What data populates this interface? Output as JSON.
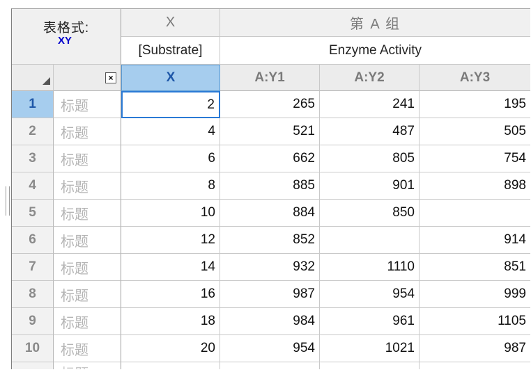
{
  "table_format": {
    "label": "表格式:",
    "value": "XY"
  },
  "x_header": {
    "name": "X",
    "title": "[Substrate]"
  },
  "group": {
    "name": "第 A 组",
    "title": "Enzyme Activity"
  },
  "columns": {
    "corner_icon": "sort-corner-icon",
    "close_icon": "close-box-icon",
    "close_glyph": "×",
    "x": "X",
    "y1": "A:Y1",
    "y2": "A:Y2",
    "y3": "A:Y3"
  },
  "rows": [
    {
      "num": "1",
      "title": "标题",
      "x": "2",
      "y1": "265",
      "y2": "241",
      "y3": "195"
    },
    {
      "num": "2",
      "title": "标题",
      "x": "4",
      "y1": "521",
      "y2": "487",
      "y3": "505"
    },
    {
      "num": "3",
      "title": "标题",
      "x": "6",
      "y1": "662",
      "y2": "805",
      "y3": "754"
    },
    {
      "num": "4",
      "title": "标题",
      "x": "8",
      "y1": "885",
      "y2": "901",
      "y3": "898"
    },
    {
      "num": "5",
      "title": "标题",
      "x": "10",
      "y1": "884",
      "y2": "850",
      "y3": ""
    },
    {
      "num": "6",
      "title": "标题",
      "x": "12",
      "y1": "852",
      "y2": "",
      "y3": "914"
    },
    {
      "num": "7",
      "title": "标题",
      "x": "14",
      "y1": "932",
      "y2": "1110",
      "y3": "851"
    },
    {
      "num": "8",
      "title": "标题",
      "x": "16",
      "y1": "987",
      "y2": "954",
      "y3": "999"
    },
    {
      "num": "9",
      "title": "标题",
      "x": "18",
      "y1": "984",
      "y2": "961",
      "y3": "1105"
    },
    {
      "num": "10",
      "title": "标题",
      "x": "20",
      "y1": "954",
      "y2": "1021",
      "y3": "987"
    }
  ],
  "partial_row_title": "标题",
  "colors": {
    "selection": "#a6cdee",
    "active_border": "#2a7ad5"
  }
}
